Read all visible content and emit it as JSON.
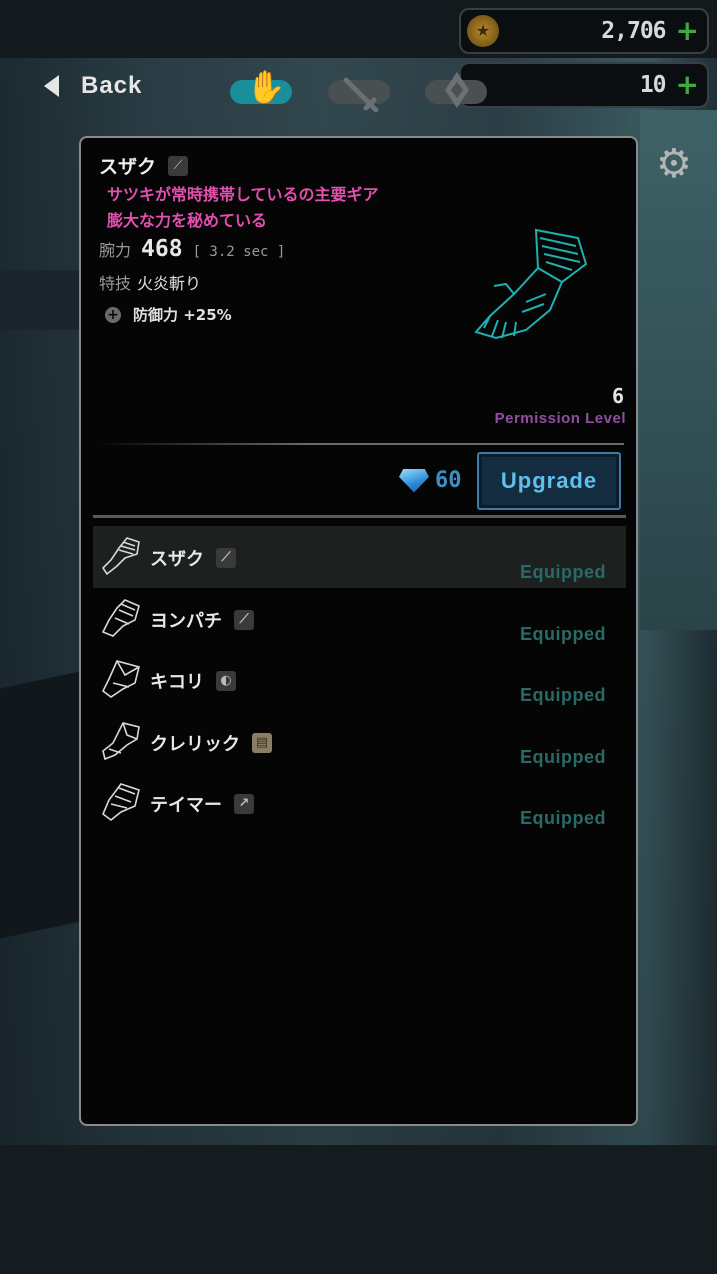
{
  "currency": {
    "coins": "2,706",
    "gems": "10",
    "plus_label": "+"
  },
  "nav": {
    "back_label": "Back"
  },
  "item": {
    "name": "スザク",
    "description_line1": "サツキが常時携帯しているの主要ギア",
    "description_line2": "膨大な力を秘めている",
    "stat_label": "腕力",
    "stat_value": "468",
    "stat_speed": "[ 3.2 sec ]",
    "skill_label": "特技",
    "skill_value": "火炎斬り",
    "bonus": "防御力 +25%",
    "permission_level_value": "6",
    "permission_level_label": "Permission Level"
  },
  "upgrade": {
    "cost": "60",
    "label": "Upgrade"
  },
  "gear_list": [
    {
      "name": "スザク",
      "status": "Equipped",
      "weapon_icon": "sword-icon"
    },
    {
      "name": "ヨンパチ",
      "status": "Equipped",
      "weapon_icon": "blade-icon"
    },
    {
      "name": "キコリ",
      "status": "Equipped",
      "weapon_icon": "axe-icon"
    },
    {
      "name": "クレリック",
      "status": "Equipped",
      "weapon_icon": "book-icon"
    },
    {
      "name": "テイマー",
      "status": "Equipped",
      "weapon_icon": "spear-icon"
    }
  ],
  "colors": {
    "accent_teal": "#3fe0ee",
    "description_pink": "#e44fb0",
    "permission_purple": "#8e4fa0",
    "upgrade_blue": "#5fc0ec",
    "equipped_teal": "#2a6a66",
    "plus_green": "#3fa83f"
  }
}
